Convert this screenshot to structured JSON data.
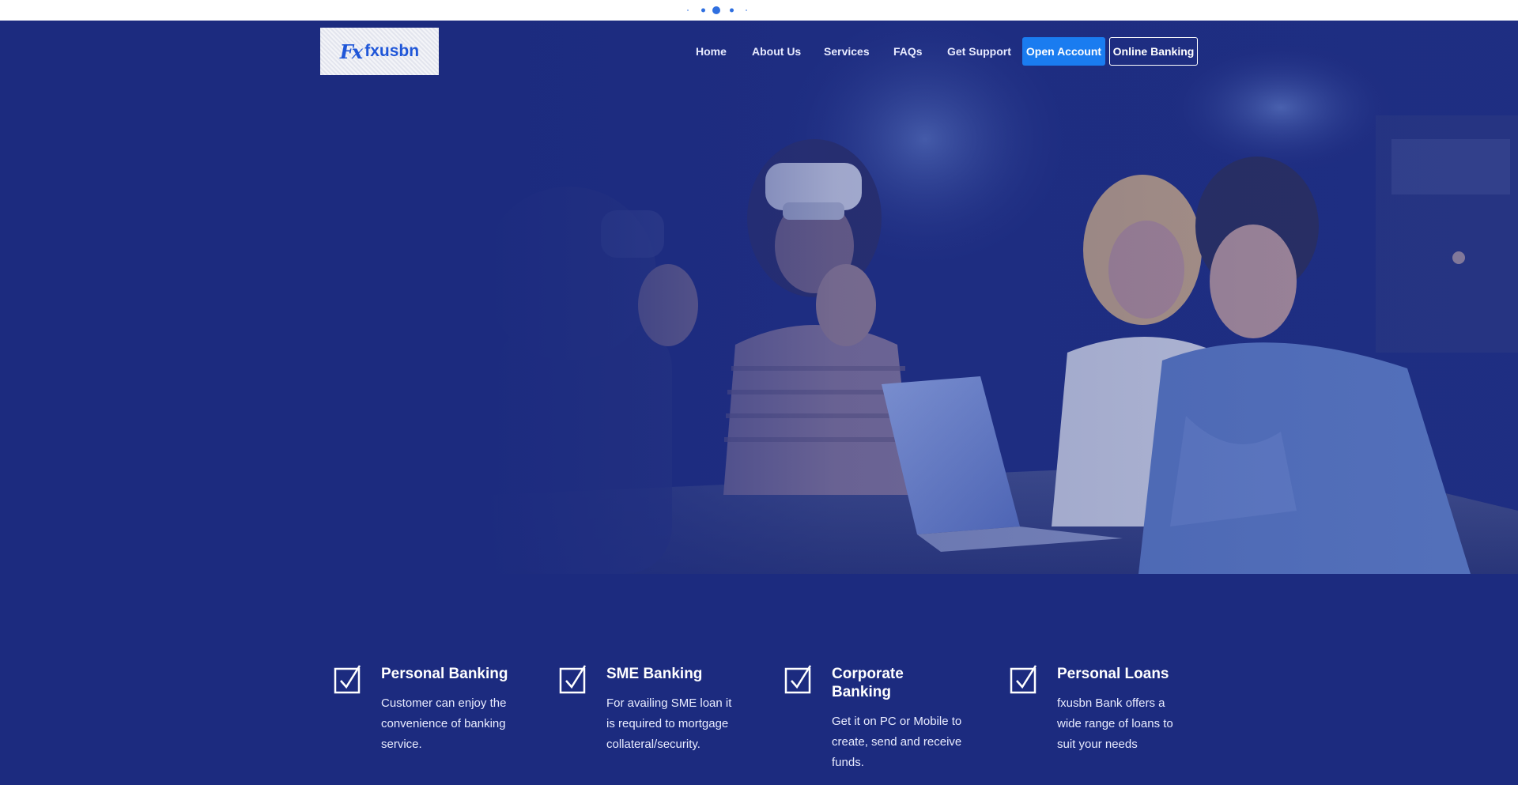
{
  "brand": {
    "logo_text": "fxusbn",
    "logo_mark": "Fx",
    "accent": "#1a7cf0",
    "background": "#1c2b7f"
  },
  "nav": {
    "links": [
      "Home",
      "About Us",
      "Services",
      "FAQs",
      "Get Support"
    ],
    "open_account": "Open Account",
    "online_banking": "Online Banking"
  },
  "services": [
    {
      "title": "Personal Banking",
      "text": "Customer can enjoy the convenience of banking service.",
      "icon": "checkbox-icon"
    },
    {
      "title": "SME Banking",
      "text": "For availing SME loan it is required to mortgage collateral/security.",
      "icon": "checkbox-icon"
    },
    {
      "title": "Corporate Banking",
      "text": "Get it on PC or Mobile to create, send and receive funds.",
      "icon": "checkbox-icon"
    },
    {
      "title": "Personal Loans",
      "text": "fxusbn Bank offers a wide range of loans to suit your needs",
      "icon": "checkbox-icon"
    }
  ]
}
